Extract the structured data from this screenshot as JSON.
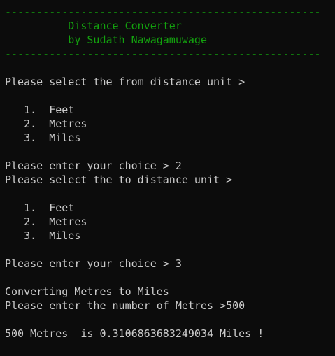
{
  "banner": {
    "divider": "--------------------------------------------------",
    "title": "          Distance Converter",
    "author": "          by Sudath Nawagamuwage"
  },
  "session": {
    "from_prompt": "Please select the from distance unit >",
    "from_options": [
      "   1.  Feet",
      "   2.  Metres",
      "   3.  Miles"
    ],
    "from_choice": "Please enter your choice > 2",
    "to_prompt": "Please select the to distance unit >",
    "to_options": [
      "   1.  Feet",
      "   2.  Metres",
      "   3.  Miles"
    ],
    "to_choice": "Please enter your choice > 3",
    "converting_msg": "Converting Metres to Miles",
    "number_prompt": "Please enter the number of Metres >500",
    "result": "500 Metres  is 0.3106863683249034 Miles !"
  },
  "colors": {
    "background": "#0c0c0c",
    "text": "#cccccc",
    "banner": "#13a10e"
  }
}
